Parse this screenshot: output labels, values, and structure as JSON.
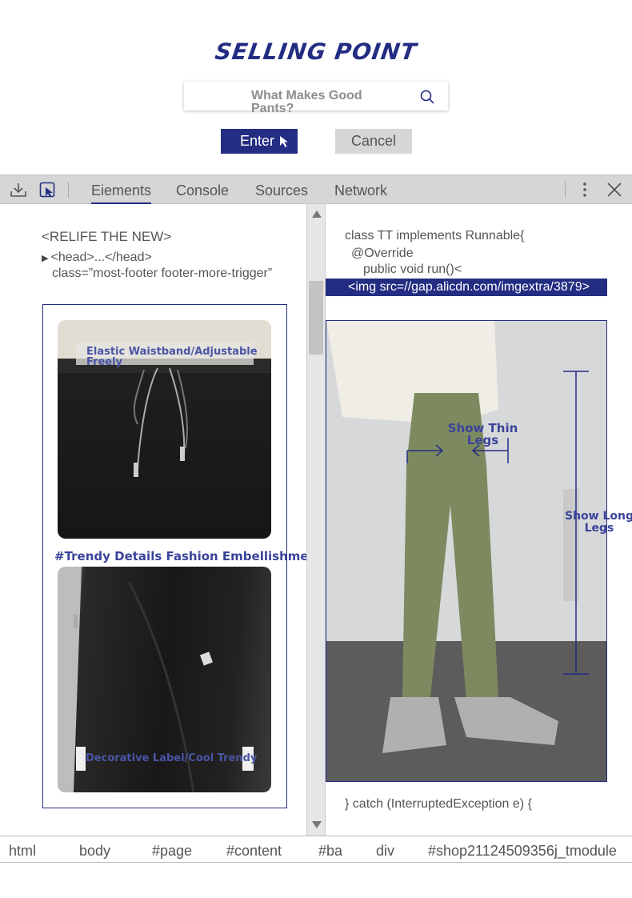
{
  "header": {
    "title": "SELLING POINT",
    "search_text": "What Makes Good Pants?",
    "enter_label": "Enter",
    "cancel_label": "Cancel"
  },
  "devtools": {
    "tabs": [
      "Eiements",
      "Console",
      "Sources",
      "Network"
    ],
    "active_tab": "Eiements"
  },
  "left_code": {
    "line1": "<RELIFE THE NEW>",
    "line2": "<head>...</head>",
    "line3": "class=”most-footer footer-more-trigger”"
  },
  "left_images": {
    "label1": "Elastic Waistband/Adjustable Freely",
    "trendy": "#Trendy Details Fashion Embellishment#",
    "label2": "Decorative Label/Cool Trendy"
  },
  "right_code": {
    "line1": "class TT implements Runnable{",
    "line2": "@Override",
    "line3": "public void run()<",
    "highlight": "<img src=//gap.alicdn.com/imgextra/3879>",
    "footer": "} catch (InterruptedException e) {"
  },
  "right_image": {
    "label_thin": "Show Thin Legs",
    "label_long": "Show Long Legs"
  },
  "breadcrumbs": [
    "html",
    "body",
    "#page",
    "#content",
    "#ba",
    "div",
    "#shop21124509356j_tmodule"
  ],
  "colors": {
    "accent": "#232d82",
    "toolbar": "#d6d6d6"
  }
}
